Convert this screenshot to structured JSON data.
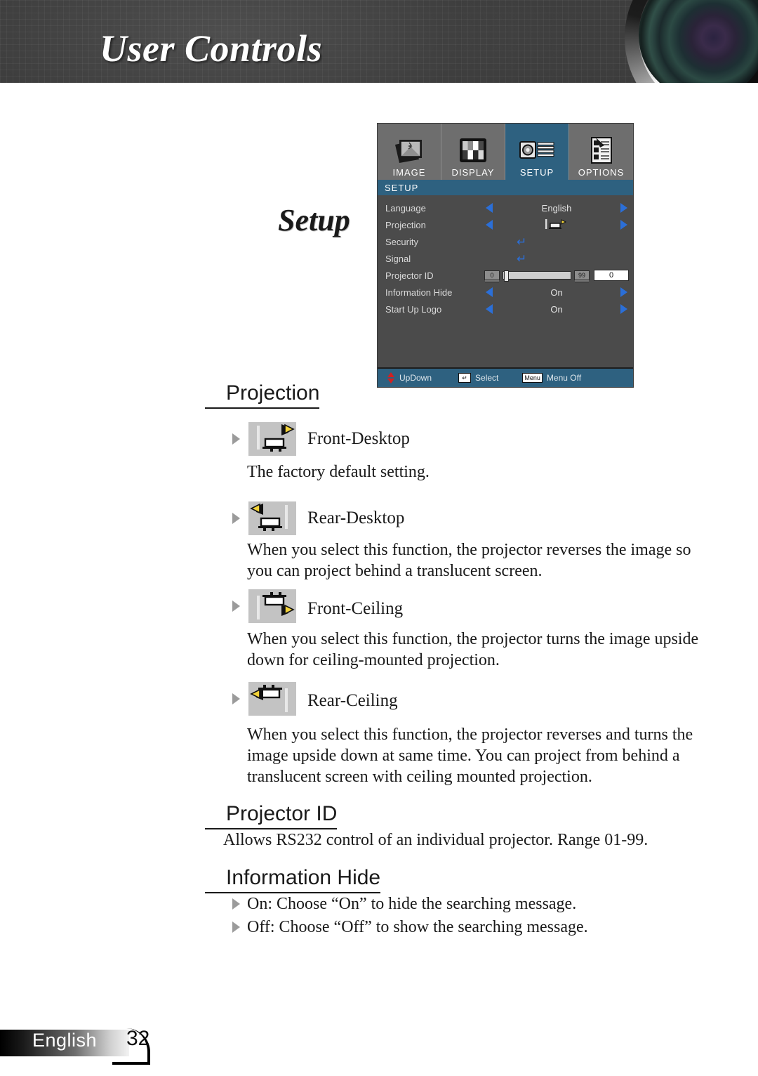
{
  "header": {
    "title": "User Controls",
    "lens_icon": "camera-lens-icon"
  },
  "page_heading": "Setup",
  "osd": {
    "tabs": [
      {
        "label": "IMAGE",
        "icon": "image-stack-icon",
        "active": false
      },
      {
        "label": "DISPLAY",
        "icon": "display-grid-icon",
        "active": false
      },
      {
        "label": "SETUP",
        "icon": "setup-panel-icon",
        "active": true
      },
      {
        "label": "OPTIONS",
        "icon": "options-list-icon",
        "active": false
      }
    ],
    "title": "SETUP",
    "rows": [
      {
        "label": "Language",
        "type": "arrows",
        "value": "English"
      },
      {
        "label": "Projection",
        "type": "arrows",
        "value": "front-desktop-icon"
      },
      {
        "label": "Security",
        "type": "enter",
        "value": "↵"
      },
      {
        "label": "Signal",
        "type": "enter",
        "value": "↵"
      },
      {
        "label": "Projector ID",
        "type": "slider",
        "min": "0",
        "max": "99",
        "value": "0"
      },
      {
        "label": "Information Hide",
        "type": "arrows",
        "value": "On"
      },
      {
        "label": "Start Up Logo",
        "type": "arrows",
        "value": "On"
      }
    ],
    "footer": [
      {
        "icon": "up-down-arrows-icon",
        "label": "UpDown"
      },
      {
        "icon": "enter-key-icon",
        "key": "↵",
        "label": "Select"
      },
      {
        "icon": "menu-key-icon",
        "key": "Menu",
        "label": "Menu Off"
      }
    ],
    "colors": {
      "accent": "#2e6180",
      "body": "#4b4b4b",
      "tab": "#6e6e6e",
      "arrow": "#2b6fd8",
      "red": "#d32020"
    }
  },
  "sections": [
    {
      "heading": "Projection",
      "options": [
        {
          "icon": "front-desktop-projection-icon",
          "label": "Front-Desktop",
          "desc": "The factory default setting."
        },
        {
          "icon": "rear-desktop-projection-icon",
          "label": "Rear-Desktop",
          "desc": "When you select this function, the projector reverses the image so you can project behind a translucent screen."
        },
        {
          "icon": "front-ceiling-projection-icon",
          "label": "Front-Ceiling",
          "desc": "When you select this function, the projector turns the image upside down for ceiling-mounted projection."
        },
        {
          "icon": "rear-ceiling-projection-icon",
          "label": "Rear-Ceiling",
          "desc": "When you select this function, the projector reverses and turns the image upside down at same time. You can project from behind a translucent screen with ceiling mounted projection."
        }
      ]
    },
    {
      "heading": "Projector ID",
      "desc": "Allows RS232 control of an individual projector. Range 01-99."
    },
    {
      "heading": "Information Hide",
      "bullets": [
        "On: Choose “On” to hide the searching message.",
        "Off: Choose “Off” to show the searching message."
      ]
    }
  ],
  "footer": {
    "language": "English",
    "page": "32"
  }
}
